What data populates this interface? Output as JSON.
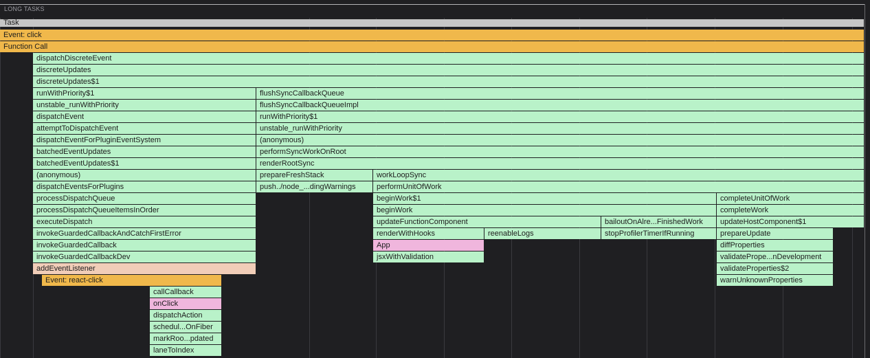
{
  "section_header": "LONG TASKS",
  "colors": {
    "background": "#1f1f22",
    "green": "#b9f2c9",
    "orange": "#f0b84b",
    "gray": "#c6c6c6",
    "pink": "#f0b6dd",
    "peach": "#f1cdb8"
  },
  "frames": [
    {
      "name": "Task",
      "depth": 0,
      "start": 0,
      "end": 1258,
      "color": "gray"
    },
    {
      "name": "Event: click",
      "depth": 1,
      "start": 0,
      "end": 1258,
      "color": "orange"
    },
    {
      "name": "Function Call",
      "depth": 2,
      "start": 0,
      "end": 1258,
      "color": "orange"
    },
    {
      "name": "dispatchDiscreteEvent",
      "depth": 3,
      "start": 48,
      "end": 1258,
      "color": "green"
    },
    {
      "name": "discreteUpdates",
      "depth": 4,
      "start": 48,
      "end": 1258,
      "color": "green"
    },
    {
      "name": "discreteUpdates$1",
      "depth": 5,
      "start": 48,
      "end": 1258,
      "color": "green"
    },
    {
      "name": "runWithPriority$1",
      "depth": 6,
      "start": 48,
      "end": 373,
      "color": "green"
    },
    {
      "name": "flushSyncCallbackQueue",
      "depth": 6,
      "start": 373,
      "end": 1258,
      "color": "green"
    },
    {
      "name": "unstable_runWithPriority",
      "depth": 7,
      "start": 48,
      "end": 373,
      "color": "green"
    },
    {
      "name": "flushSyncCallbackQueueImpl",
      "depth": 7,
      "start": 373,
      "end": 1258,
      "color": "green"
    },
    {
      "name": "dispatchEvent",
      "depth": 8,
      "start": 48,
      "end": 373,
      "color": "green"
    },
    {
      "name": "runWithPriority$1",
      "depth": 8,
      "start": 373,
      "end": 1258,
      "color": "green"
    },
    {
      "name": "attemptToDispatchEvent",
      "depth": 9,
      "start": 48,
      "end": 373,
      "color": "green"
    },
    {
      "name": "unstable_runWithPriority",
      "depth": 9,
      "start": 373,
      "end": 1258,
      "color": "green"
    },
    {
      "name": "dispatchEventForPluginEventSystem",
      "depth": 10,
      "start": 48,
      "end": 373,
      "color": "green"
    },
    {
      "name": "(anonymous)",
      "depth": 10,
      "start": 373,
      "end": 1258,
      "color": "green"
    },
    {
      "name": "batchedEventUpdates",
      "depth": 11,
      "start": 48,
      "end": 373,
      "color": "green"
    },
    {
      "name": "performSyncWorkOnRoot",
      "depth": 11,
      "start": 373,
      "end": 1258,
      "color": "green"
    },
    {
      "name": "batchedEventUpdates$1",
      "depth": 12,
      "start": 48,
      "end": 373,
      "color": "green"
    },
    {
      "name": "renderRootSync",
      "depth": 12,
      "start": 373,
      "end": 1258,
      "color": "green"
    },
    {
      "name": "(anonymous)",
      "depth": 13,
      "start": 48,
      "end": 373,
      "color": "green"
    },
    {
      "name": "prepareFreshStack",
      "depth": 13,
      "start": 373,
      "end": 543,
      "color": "green"
    },
    {
      "name": "workLoopSync",
      "depth": 13,
      "start": 543,
      "end": 1258,
      "color": "green"
    },
    {
      "name": "dispatchEventsForPlugins",
      "depth": 14,
      "start": 48,
      "end": 373,
      "color": "green"
    },
    {
      "name": "push../node_...dingWarnings",
      "depth": 14,
      "start": 373,
      "end": 543,
      "color": "green"
    },
    {
      "name": "performUnitOfWork",
      "depth": 14,
      "start": 543,
      "end": 1258,
      "color": "green"
    },
    {
      "name": "processDispatchQueue",
      "depth": 15,
      "start": 48,
      "end": 373,
      "color": "green"
    },
    {
      "name": "beginWork$1",
      "depth": 15,
      "start": 543,
      "end": 1043,
      "color": "green"
    },
    {
      "name": "completeUnitOfWork",
      "depth": 15,
      "start": 1043,
      "end": 1258,
      "color": "green"
    },
    {
      "name": "processDispatchQueueItemsInOrder",
      "depth": 16,
      "start": 48,
      "end": 373,
      "color": "green"
    },
    {
      "name": "beginWork",
      "depth": 16,
      "start": 543,
      "end": 1043,
      "color": "green"
    },
    {
      "name": "completeWork",
      "depth": 16,
      "start": 1043,
      "end": 1258,
      "color": "green"
    },
    {
      "name": "executeDispatch",
      "depth": 17,
      "start": 48,
      "end": 373,
      "color": "green"
    },
    {
      "name": "updateFunctionComponent",
      "depth": 17,
      "start": 543,
      "end": 875,
      "color": "green"
    },
    {
      "name": "bailoutOnAlre...FinishedWork",
      "depth": 17,
      "start": 875,
      "end": 1043,
      "color": "green"
    },
    {
      "name": "updateHostComponent$1",
      "depth": 17,
      "start": 1043,
      "end": 1258,
      "color": "green"
    },
    {
      "name": "invokeGuardedCallbackAndCatchFirstError",
      "depth": 18,
      "start": 48,
      "end": 373,
      "color": "green"
    },
    {
      "name": "renderWithHooks",
      "depth": 18,
      "start": 543,
      "end": 705,
      "color": "green"
    },
    {
      "name": "reenableLogs",
      "depth": 18,
      "start": 705,
      "end": 875,
      "color": "green"
    },
    {
      "name": "stopProfilerTimerIfRunning",
      "depth": 18,
      "start": 875,
      "end": 1043,
      "color": "green"
    },
    {
      "name": "prepareUpdate",
      "depth": 18,
      "start": 1043,
      "end": 1213,
      "color": "green"
    },
    {
      "name": "invokeGuardedCallback",
      "depth": 19,
      "start": 48,
      "end": 373,
      "color": "green"
    },
    {
      "name": "App",
      "depth": 19,
      "start": 543,
      "end": 705,
      "color": "pink"
    },
    {
      "name": "diffProperties",
      "depth": 19,
      "start": 1043,
      "end": 1213,
      "color": "green"
    },
    {
      "name": "invokeGuardedCallbackDev",
      "depth": 20,
      "start": 48,
      "end": 373,
      "color": "green"
    },
    {
      "name": "jsxWithValidation",
      "depth": 20,
      "start": 543,
      "end": 705,
      "color": "green"
    },
    {
      "name": "validatePrope...nDevelopment",
      "depth": 20,
      "start": 1043,
      "end": 1213,
      "color": "green"
    },
    {
      "name": "addEventListener",
      "depth": 21,
      "start": 48,
      "end": 373,
      "color": "peach"
    },
    {
      "name": "validateProperties$2",
      "depth": 21,
      "start": 1043,
      "end": 1213,
      "color": "green"
    },
    {
      "name": "Event: react-click",
      "depth": 22,
      "start": 61,
      "end": 323,
      "color": "orange"
    },
    {
      "name": "warnUnknownProperties",
      "depth": 22,
      "start": 1043,
      "end": 1213,
      "color": "green"
    },
    {
      "name": "callCallback",
      "depth": 23,
      "start": 218,
      "end": 323,
      "color": "green"
    },
    {
      "name": "onClick",
      "depth": 24,
      "start": 218,
      "end": 323,
      "color": "pink"
    },
    {
      "name": "dispatchAction",
      "depth": 25,
      "start": 218,
      "end": 323,
      "color": "green"
    },
    {
      "name": "schedul...OnFiber",
      "depth": 26,
      "start": 218,
      "end": 323,
      "color": "green"
    },
    {
      "name": "markRoo...pdated",
      "depth": 27,
      "start": 218,
      "end": 323,
      "color": "green"
    },
    {
      "name": "laneToIndex",
      "depth": 28,
      "start": 218,
      "end": 323,
      "color": "green"
    }
  ]
}
